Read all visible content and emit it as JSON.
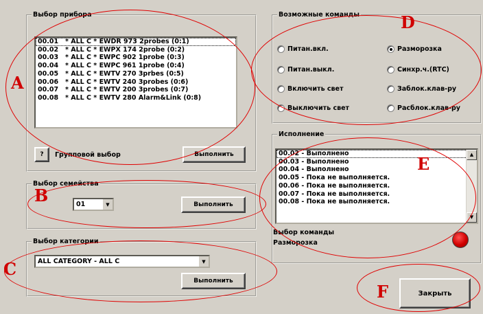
{
  "device_select": {
    "legend": "Выбор прибора",
    "items": [
      "00.01   * ALL C * EWDR 973 2probes (0:1)",
      "00.02   * ALL C * EWPX 174 2probe (0:2)",
      "00.03   * ALL C * EWPC 902 1probe (0:3)",
      "00.04   * ALL C * EWPC 961 1probe (0:4)",
      "00.05   * ALL C * EWTV 270 3prbes (0:5)",
      "00.06   * ALL C * EWTV 240 3probes (0:6)",
      "00.07   * ALL C * EWTV 200 3probes (0:7)",
      "00.08   * ALL C * EWTV 280 Alarm&Link (0:8)"
    ],
    "help_label": "?",
    "group_label": "Групповой выбор",
    "execute_label": "Выполнить"
  },
  "family_select": {
    "legend": "Выбор семейства",
    "value": "01",
    "execute_label": "Выполнить"
  },
  "category_select": {
    "legend": "Выбор категории",
    "value": "ALL CATEGORY - ALL C",
    "execute_label": "Выполнить"
  },
  "commands": {
    "legend": "Возможные команды",
    "options": [
      {
        "label": "Питан.вкл.",
        "selected": false
      },
      {
        "label": "Разморозка",
        "selected": true
      },
      {
        "label": "Питан.выкл.",
        "selected": false
      },
      {
        "label": "Синхр.ч.(RTC)",
        "selected": false
      },
      {
        "label": "Включить свет",
        "selected": false
      },
      {
        "label": "Заблок.клав-ру",
        "selected": false
      },
      {
        "label": "Выключить свет",
        "selected": false
      },
      {
        "label": "Расблок.клав-ру",
        "selected": false
      }
    ]
  },
  "execution": {
    "legend": "Исполнение",
    "log": [
      "00.02 - Выполнено",
      "00.03 - Выполнено",
      "00.04 - Выполнено",
      "00.05 - Пока не выполняется.",
      "00.06 - Пока не выполняется.",
      "00.07 - Пока не выполняется.",
      "00.08 - Пока не выполняется."
    ],
    "command_caption": "Выбор команды",
    "command_value": "Разморозка",
    "indicator_color": "#d00000"
  },
  "close_label": "Закрыть",
  "annotations": {
    "markers": [
      "A",
      "B",
      "C",
      "D",
      "E",
      "F"
    ],
    "color": "#e00000"
  }
}
